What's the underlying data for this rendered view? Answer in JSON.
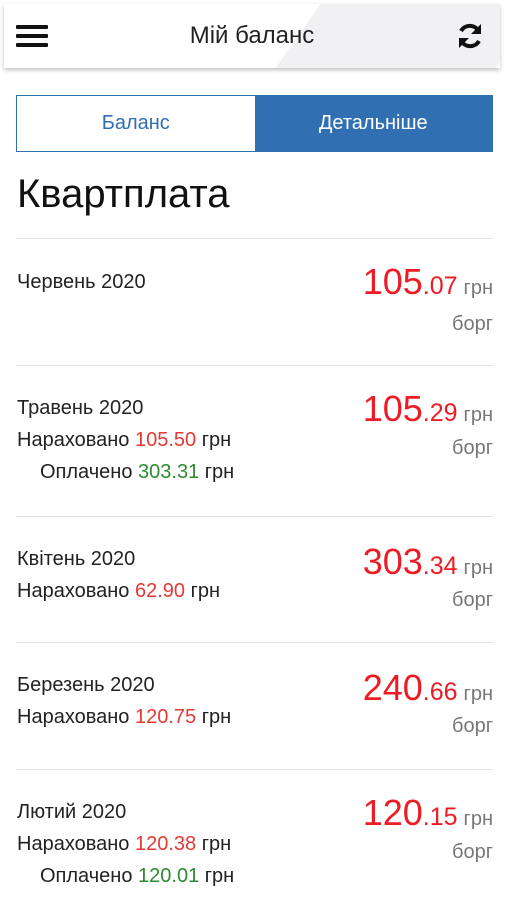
{
  "header": {
    "title": "Мій баланс",
    "menu_icon": "hamburger-menu-icon",
    "refresh_icon": "refresh-icon"
  },
  "tabs": [
    {
      "label": "Баланс",
      "active": false
    },
    {
      "label": "Детальніше",
      "active": true
    }
  ],
  "section": {
    "title": "Квартплата"
  },
  "labels": {
    "accrued": "Нараховано",
    "paid": "Оплачено",
    "currency": "грн"
  },
  "rows": [
    {
      "month": "Червень 2020",
      "amount_int": "105",
      "amount_dec": ".07",
      "status": "борг"
    },
    {
      "month": "Травень 2020",
      "accrued": "105.50",
      "paid": "303.31",
      "amount_int": "105",
      "amount_dec": ".29",
      "status": "борг"
    },
    {
      "month": "Квітень 2020",
      "accrued": "62.90",
      "amount_int": "303",
      "amount_dec": ".34",
      "status": "борг"
    },
    {
      "month": "Березень 2020",
      "accrued": "120.75",
      "amount_int": "240",
      "amount_dec": ".66",
      "status": "борг"
    },
    {
      "month": "Лютий 2020",
      "accrued": "120.38",
      "paid": "120.01",
      "amount_int": "120",
      "amount_dec": ".15",
      "status": "борг"
    }
  ],
  "colors": {
    "accent": "#2f6fb2",
    "debt": "#ed1c24",
    "paid": "#2e8b32"
  }
}
